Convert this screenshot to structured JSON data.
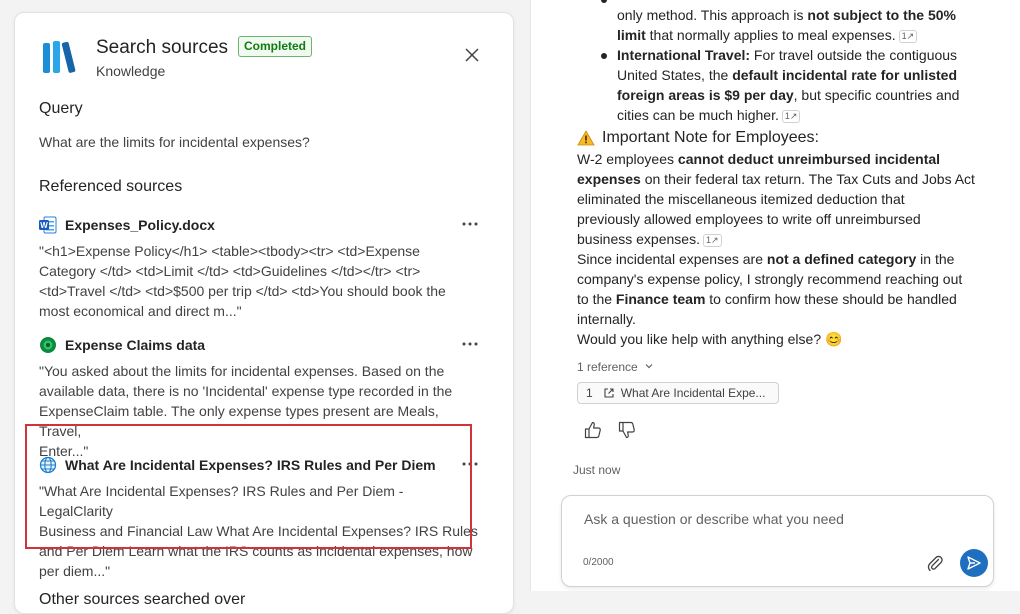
{
  "panel": {
    "title": "Search sources",
    "badge": "Completed",
    "subtitle": "Knowledge",
    "query_heading": "Query",
    "query_text": "What are the limits for incidental expenses?",
    "referenced_heading": "Referenced sources",
    "other_heading": "Other sources searched over",
    "sources": [
      {
        "icon": "word-doc-icon",
        "title": "Expenses_Policy.docx",
        "lines": [
          "\"<h1>Expense Policy</h1> <table><tbody><tr> <td>Expense",
          "Category </td> <td>Limit </td> <td>Guidelines </td></tr> <tr>",
          "<td>Travel </td> <td>$500 per trip </td> <td>You should book the",
          "most economical and direct m...\""
        ]
      },
      {
        "icon": "dataverse-icon",
        "title": "Expense Claims data",
        "lines": [
          "\"You asked about the limits for incidental expenses. Based on the",
          "available data, there is no 'Incidental' expense type recorded in the",
          "ExpenseClaim table. The only expense types present are Meals, Travel,",
          "Enter...\""
        ]
      },
      {
        "icon": "globe-icon",
        "title": "What Are Incidental Expenses? IRS Rules and Per Diem",
        "lines": [
          "\"What Are Incidental Expenses? IRS Rules and Per Diem - LegalClarity",
          "Business and Financial Law What Are Incidental Expenses? IRS Rules",
          "and Per Diem Learn what the IRS counts as incidental expenses, how",
          "per diem...\""
        ]
      }
    ]
  },
  "answer": {
    "l1_pre": "only method. This approach is ",
    "l1_bold": "not subject to the 50%",
    "l2_bold": "limit",
    "l2_post": " that normally applies to meal expenses.",
    "l3_bold": "International Travel:",
    "l3_post": " For travel outside the contiguous",
    "l4": "United States, the ",
    "l4_bold": "default incidental rate for unlisted",
    "l5_bold": "foreign areas is $9 per day",
    "l5_post": ", but specific countries and",
    "l6": "cities can be much higher.",
    "note_heading": "Important Note for Employees:",
    "p1_pre": "W-2 employees ",
    "p1_bold": "cannot deduct unreimbursed incidental",
    "p2_bold": "expenses",
    "p2_post": " on their federal tax return. The Tax Cuts and Jobs Act",
    "p3": "eliminated the miscellaneous itemized deduction that",
    "p4": "previously allowed employees to write off unreimbursed",
    "p5": "business expenses.",
    "p6_pre": "Since incidental expenses are ",
    "p6_bold": "not a defined category",
    "p6_post": " in the",
    "p7": "company's expense policy, I strongly recommend reaching out",
    "p8_pre": "to the ",
    "p8_bold": "Finance team",
    "p8_post": " to confirm how these should be handled",
    "p9": "internally.",
    "p10": "Would you like help with anything else? 😊",
    "cite_label": "1",
    "reference_count": "1 reference",
    "ref_num": "1",
    "ref_title": "What Are Incidental Expe...",
    "timestamp": "Just now"
  },
  "composer": {
    "placeholder": "Ask a question or describe what you need",
    "counter": "0/2000"
  }
}
